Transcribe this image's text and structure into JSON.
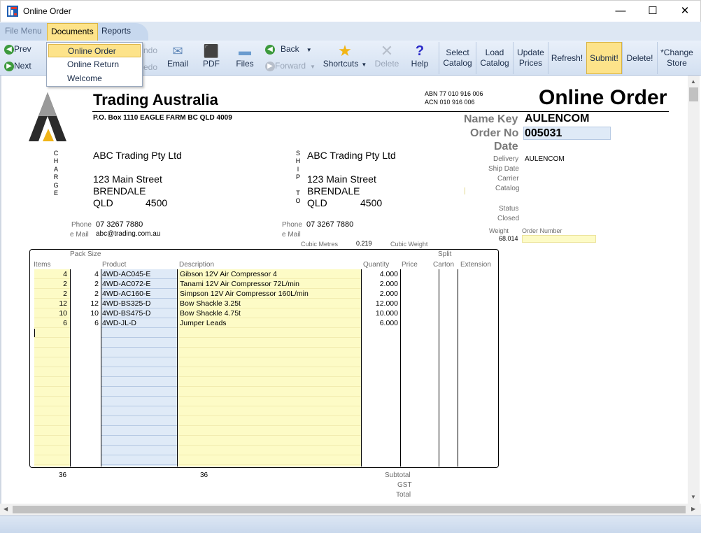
{
  "window": {
    "title": "Online Order",
    "minimize": "—",
    "maximize": "☐",
    "close": "✕"
  },
  "menu": {
    "file_menu": "File Menu",
    "documents": "Documents",
    "reports": "Reports"
  },
  "dropdown": {
    "items": [
      "Online Order",
      "Online Return",
      "Welcome"
    ],
    "hidden_undo": "ndo",
    "hidden_redo": "edo"
  },
  "toolbar": {
    "prev": "Prev",
    "next": "Next",
    "email": "Email",
    "pdf": "PDF",
    "files": "Files",
    "back": "Back",
    "forward": "Forward",
    "shortcuts": "Shortcuts",
    "delete": "Delete",
    "help": "Help",
    "select_catalog": [
      "Select",
      "Catalog"
    ],
    "load_catalog": [
      "Load",
      "Catalog"
    ],
    "update_prices": [
      "Update",
      "Prices"
    ],
    "refresh": "Refresh!",
    "submit": "Submit!",
    "delete_bang": "Delete!",
    "change_store": [
      "*Change",
      "Store"
    ]
  },
  "company": {
    "name": "Trading Australia",
    "address": "P.O. Box 1110 EAGLE FARM BC QLD 4009",
    "abn": "ABN 77 010 916 006",
    "acn": "ACN 010 916 006"
  },
  "doc_title": "Online Order",
  "charge_label": "CHARGE",
  "ship_label": [
    "S",
    "H",
    "I",
    "P",
    "",
    "T",
    "O"
  ],
  "charge": {
    "name": "ABC Trading Pty Ltd",
    "street": "123 Main Street",
    "city": "BRENDALE",
    "state": "QLD",
    "postcode": "4500",
    "phone_label": "Phone",
    "phone": "07 3267 7880",
    "email_label": "e Mail",
    "email": "abc@trading.com.au"
  },
  "ship": {
    "name": "ABC Trading Pty Ltd",
    "street": "123 Main Street",
    "city": "BRENDALE",
    "state": "QLD",
    "postcode": "4500",
    "phone_label": "Phone",
    "phone": "07 3267 7880",
    "email_label": "e Mail",
    "email": ""
  },
  "cubic_metres_label": "Cubic Metres",
  "cubic_metres": "0.219",
  "cubic_weight_label": "Cubic Weight",
  "info": {
    "name_key_label": "Name Key",
    "name_key": "AULENCOM",
    "order_no_label": "Order No",
    "order_no": "005031",
    "date_label": "Date",
    "delivery_label": "Delivery",
    "delivery": "AULENCOM",
    "ship_date_label": "Ship Date",
    "carrier_label": "Carrier",
    "catalog_label": "Catalog",
    "status_label": "Status",
    "closed_label": "Closed",
    "weight_label": "Weight",
    "weight": "68.014",
    "order_number_label": "Order Number",
    "order_number": ""
  },
  "grid": {
    "headers": {
      "pack_size": "Pack Size",
      "items": "Items",
      "product": "Product",
      "description": "Description",
      "quantity": "Quantity",
      "price": "Price",
      "split": "Split",
      "carton": "Carton",
      "extension": "Extension"
    },
    "rows": [
      {
        "items": "4",
        "pack": "4",
        "product": "4WD-AC045-E",
        "description": "Gibson 12V Air Compressor 4",
        "quantity": "4.000"
      },
      {
        "items": "2",
        "pack": "2",
        "product": "4WD-AC072-E",
        "description": "Tanami 12V Air Compressor 72L/min",
        "quantity": "2.000"
      },
      {
        "items": "2",
        "pack": "2",
        "product": "4WD-AC160-E",
        "description": "Simpson 12V Air Compressor 160L/min",
        "quantity": "2.000"
      },
      {
        "items": "12",
        "pack": "12",
        "product": "4WD-BS325-D",
        "description": "Bow Shackle 3.25t",
        "quantity": "12.000"
      },
      {
        "items": "10",
        "pack": "10",
        "product": "4WD-BS475-D",
        "description": "Bow Shackle 4.75t",
        "quantity": "10.000"
      },
      {
        "items": "6",
        "pack": "6",
        "product": "4WD-JL-D",
        "description": "Jumper Leads",
        "quantity": "6.000"
      }
    ],
    "total_items": "36",
    "total_pack": "36"
  },
  "totals": {
    "subtotal_label": "Subtotal",
    "gst_label": "GST",
    "total_label": "Total"
  },
  "colors": {
    "accent_yellow": "#fde38a",
    "row_yellow": "#fdfbc6",
    "row_blue": "#dfeaf7",
    "toolbar_blue": "#d3e0f1"
  }
}
